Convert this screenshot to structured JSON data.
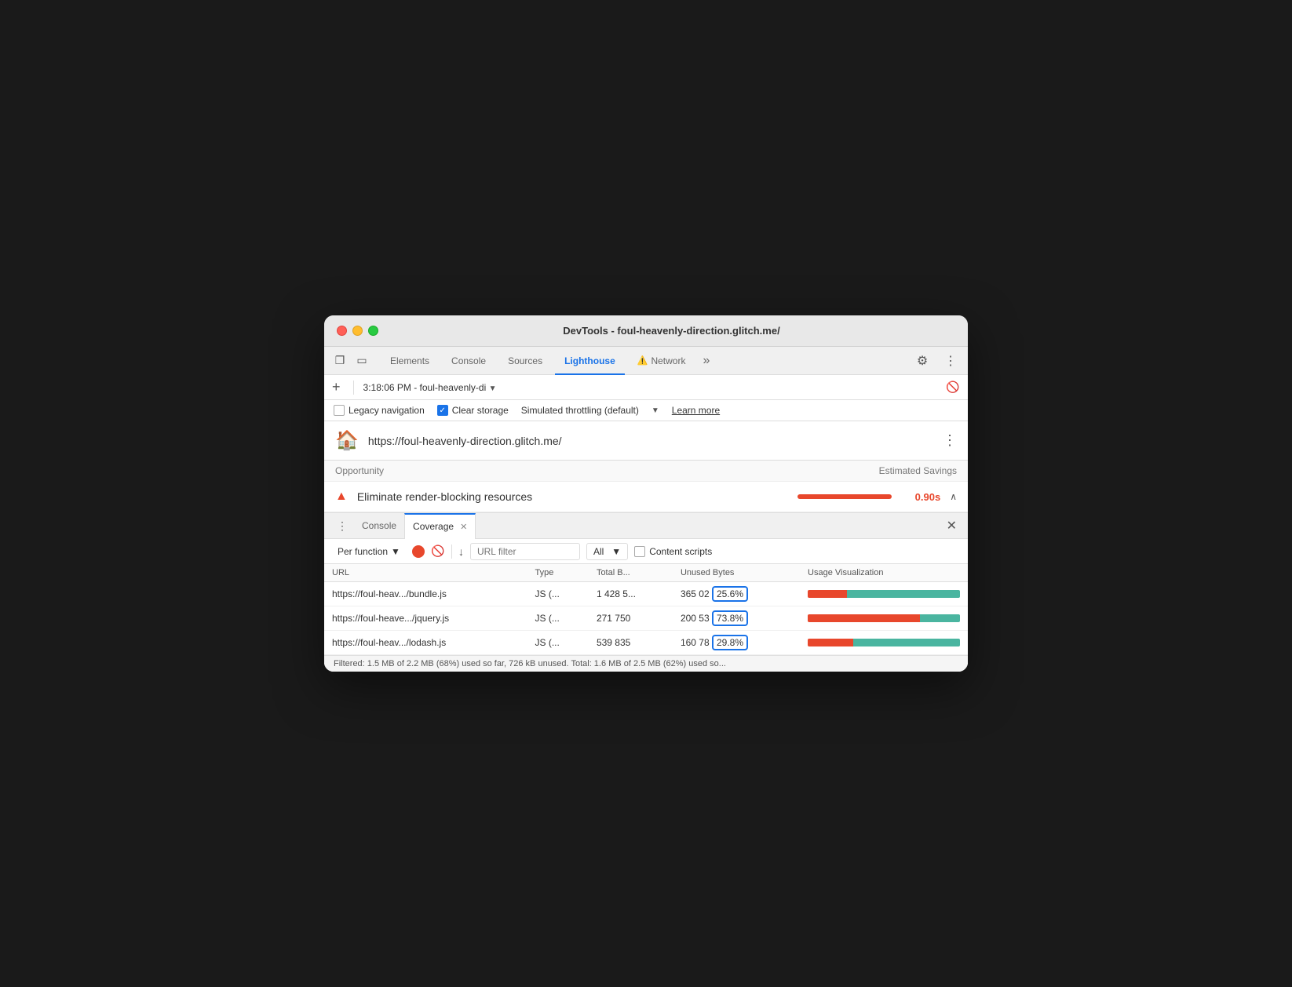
{
  "window": {
    "title": "DevTools - foul-heavenly-direction.glitch.me/"
  },
  "tabs": {
    "items": [
      {
        "label": "Elements",
        "active": false,
        "warning": false
      },
      {
        "label": "Console",
        "active": false,
        "warning": false
      },
      {
        "label": "Sources",
        "active": false,
        "warning": false
      },
      {
        "label": "Lighthouse",
        "active": true,
        "warning": false
      },
      {
        "label": "Network",
        "active": false,
        "warning": true
      }
    ],
    "more_label": "»",
    "settings_icon": "⚙",
    "more_icon": "⋮"
  },
  "toolbar": {
    "add_icon": "+",
    "timestamp": "3:18:06 PM - foul-heavenly-di",
    "dropdown_icon": "▼",
    "block_icon": "🚫"
  },
  "options": {
    "legacy_nav_label": "Legacy navigation",
    "legacy_checked": false,
    "clear_storage_label": "Clear storage",
    "clear_checked": true,
    "throttling_label": "Simulated throttling (default)",
    "learn_more_label": "Learn more",
    "dropdown_icon": "▼"
  },
  "lighthouse": {
    "icon": "🏠",
    "url": "https://foul-heavenly-direction.glitch.me/",
    "more_icon": "⋮"
  },
  "audit": {
    "opportunity_label": "Opportunity",
    "estimated_savings_label": "Estimated Savings",
    "row": {
      "icon": "▲",
      "label": "Eliminate render-blocking resources",
      "time": "0.90s",
      "chevron": "∧"
    }
  },
  "bottom_panel": {
    "more_icon": "⋮",
    "tabs": [
      {
        "label": "Console",
        "active": false,
        "closeable": false
      },
      {
        "label": "Coverage",
        "active": true,
        "closeable": true
      }
    ],
    "close_icon": "✕"
  },
  "coverage": {
    "per_function_label": "Per function",
    "dropdown_icon": "▼",
    "record_btn": "record",
    "stop_btn": "🚫",
    "download_label": "↓",
    "url_filter_placeholder": "URL filter",
    "all_label": "All",
    "all_dropdown": "▼",
    "content_scripts_label": "Content scripts",
    "columns": [
      {
        "key": "url",
        "label": "URL"
      },
      {
        "key": "type",
        "label": "Type"
      },
      {
        "key": "total",
        "label": "Total B..."
      },
      {
        "key": "unused",
        "label": "Unused Bytes"
      },
      {
        "key": "viz",
        "label": "Usage Visualization"
      }
    ],
    "rows": [
      {
        "url": "https://foul-heav.../bundle.js",
        "type": "JS (...",
        "total": "1 428 5...",
        "unused_bytes": "365 02",
        "unused_pct": "25.6%",
        "used_pct": 74.4,
        "unused_pct_num": 25.6,
        "highlight": true
      },
      {
        "url": "https://foul-heave.../jquery.js",
        "type": "JS (...",
        "total": "271 750",
        "unused_bytes": "200 53",
        "unused_pct": "73.8%",
        "used_pct": 26.2,
        "unused_pct_num": 73.8,
        "highlight": true
      },
      {
        "url": "https://foul-heav.../lodash.js",
        "type": "JS (...",
        "total": "539 835",
        "unused_bytes": "160 78",
        "unused_pct": "29.8%",
        "used_pct": 70.2,
        "unused_pct_num": 29.8,
        "highlight": true
      }
    ],
    "status_bar": "Filtered: 1.5 MB of 2.2 MB (68%) used so far, 726 kB unused. Total: 1.6 MB of 2.5 MB (62%) used so..."
  }
}
